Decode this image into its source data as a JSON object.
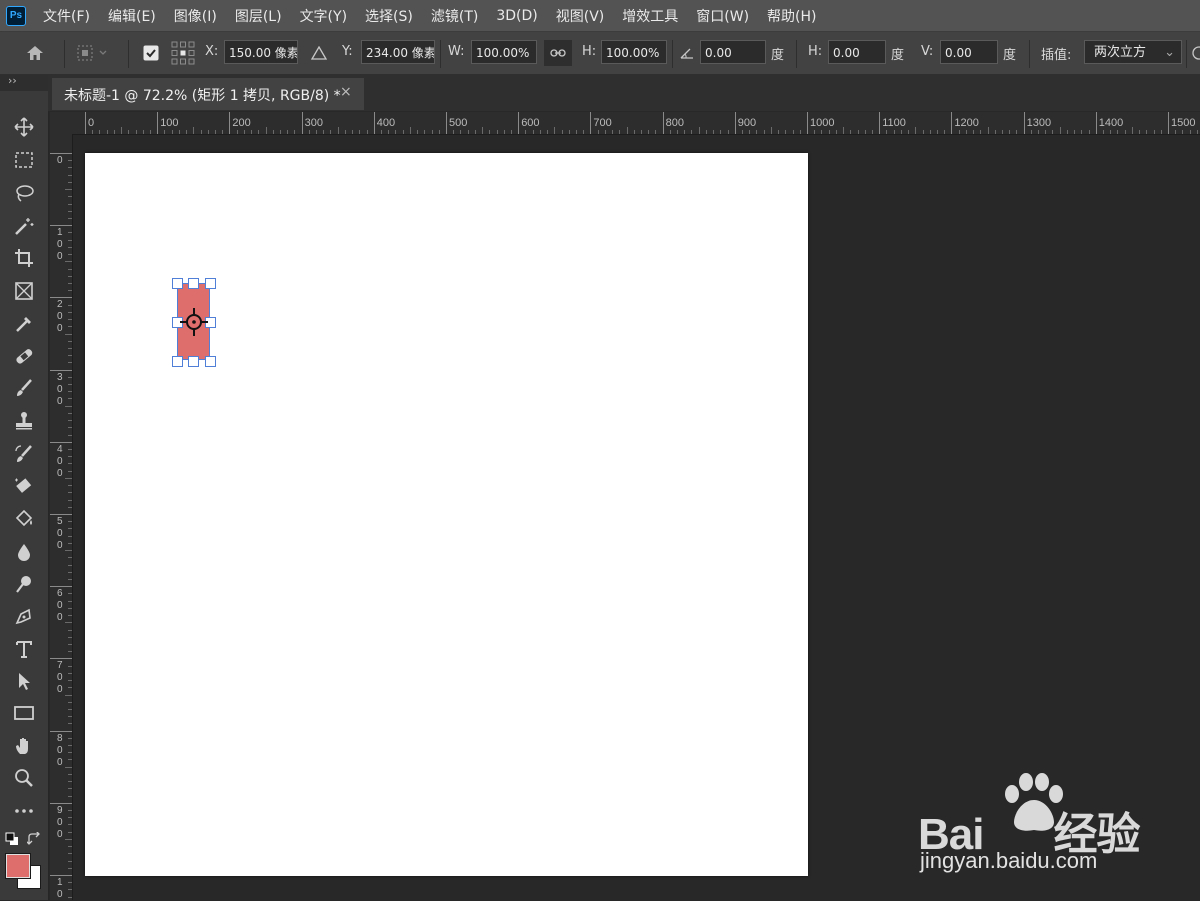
{
  "app": {
    "logo_text": "Ps",
    "menu": [
      "文件(F)",
      "编辑(E)",
      "图像(I)",
      "图层(L)",
      "文字(Y)",
      "选择(S)",
      "滤镜(T)",
      "3D(D)",
      "视图(V)",
      "增效工具",
      "窗口(W)",
      "帮助(H)"
    ]
  },
  "options": {
    "x_label": "X:",
    "x_value": "150.00 像素",
    "y_label": "Y:",
    "y_value": "234.00 像素",
    "w_label": "W:",
    "w_value": "100.00%",
    "h_label": "H:",
    "h_value": "100.00%",
    "angle_value": "0.00",
    "angle_unit": "度",
    "skew_h_label": "H:",
    "skew_h_value": "0.00",
    "skew_h_unit": "度",
    "skew_v_label": "V:",
    "skew_v_value": "0.00",
    "skew_v_unit": "度",
    "interp_label": "插值:",
    "interp_value": "两次立方"
  },
  "document": {
    "tab_title": "未标题-1 @ 72.2% (矩形 1 拷贝, RGB/8) *",
    "close_glyph": "×"
  },
  "rulers": {
    "horizontal_labels": [
      "0",
      "100",
      "200",
      "300",
      "400",
      "500",
      "600",
      "700",
      "800",
      "900",
      "1000",
      "1100",
      "1200",
      "1300",
      "1400",
      "1500"
    ],
    "vertical_labels": [
      "0",
      "100",
      "200",
      "300",
      "400",
      "500",
      "600",
      "700",
      "800",
      "900",
      "10"
    ]
  },
  "colors": {
    "foreground": "#dd6e6c",
    "background": "#ffffff",
    "shape_fill": "#dd6e6c",
    "selection": "#4f7fd6"
  },
  "watermark": {
    "brand_text": "Bai du 经验",
    "url": "jingyan.baidu.com"
  }
}
